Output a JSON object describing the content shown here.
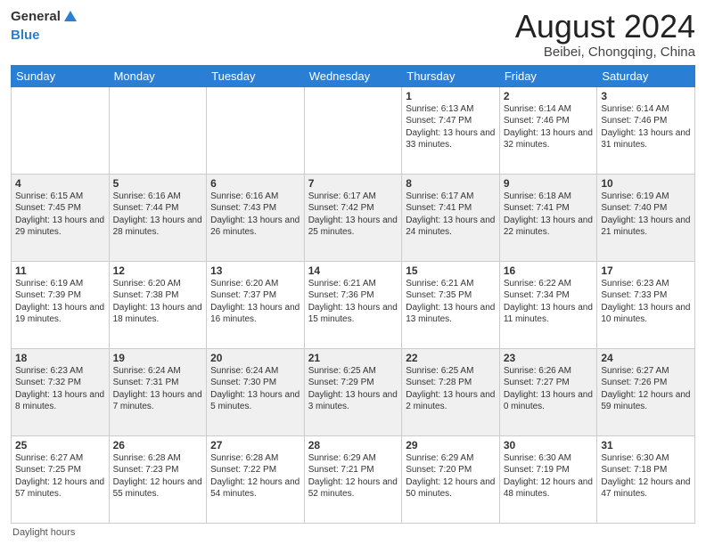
{
  "header": {
    "logo_general": "General",
    "logo_blue": "Blue",
    "month_year": "August 2024",
    "location": "Beibei, Chongqing, China"
  },
  "days_of_week": [
    "Sunday",
    "Monday",
    "Tuesday",
    "Wednesday",
    "Thursday",
    "Friday",
    "Saturday"
  ],
  "weeks": [
    [
      {
        "day": "",
        "info": ""
      },
      {
        "day": "",
        "info": ""
      },
      {
        "day": "",
        "info": ""
      },
      {
        "day": "",
        "info": ""
      },
      {
        "day": "1",
        "info": "Sunrise: 6:13 AM\nSunset: 7:47 PM\nDaylight: 13 hours and 33 minutes."
      },
      {
        "day": "2",
        "info": "Sunrise: 6:14 AM\nSunset: 7:46 PM\nDaylight: 13 hours and 32 minutes."
      },
      {
        "day": "3",
        "info": "Sunrise: 6:14 AM\nSunset: 7:46 PM\nDaylight: 13 hours and 31 minutes."
      }
    ],
    [
      {
        "day": "4",
        "info": "Sunrise: 6:15 AM\nSunset: 7:45 PM\nDaylight: 13 hours and 29 minutes."
      },
      {
        "day": "5",
        "info": "Sunrise: 6:16 AM\nSunset: 7:44 PM\nDaylight: 13 hours and 28 minutes."
      },
      {
        "day": "6",
        "info": "Sunrise: 6:16 AM\nSunset: 7:43 PM\nDaylight: 13 hours and 26 minutes."
      },
      {
        "day": "7",
        "info": "Sunrise: 6:17 AM\nSunset: 7:42 PM\nDaylight: 13 hours and 25 minutes."
      },
      {
        "day": "8",
        "info": "Sunrise: 6:17 AM\nSunset: 7:41 PM\nDaylight: 13 hours and 24 minutes."
      },
      {
        "day": "9",
        "info": "Sunrise: 6:18 AM\nSunset: 7:41 PM\nDaylight: 13 hours and 22 minutes."
      },
      {
        "day": "10",
        "info": "Sunrise: 6:19 AM\nSunset: 7:40 PM\nDaylight: 13 hours and 21 minutes."
      }
    ],
    [
      {
        "day": "11",
        "info": "Sunrise: 6:19 AM\nSunset: 7:39 PM\nDaylight: 13 hours and 19 minutes."
      },
      {
        "day": "12",
        "info": "Sunrise: 6:20 AM\nSunset: 7:38 PM\nDaylight: 13 hours and 18 minutes."
      },
      {
        "day": "13",
        "info": "Sunrise: 6:20 AM\nSunset: 7:37 PM\nDaylight: 13 hours and 16 minutes."
      },
      {
        "day": "14",
        "info": "Sunrise: 6:21 AM\nSunset: 7:36 PM\nDaylight: 13 hours and 15 minutes."
      },
      {
        "day": "15",
        "info": "Sunrise: 6:21 AM\nSunset: 7:35 PM\nDaylight: 13 hours and 13 minutes."
      },
      {
        "day": "16",
        "info": "Sunrise: 6:22 AM\nSunset: 7:34 PM\nDaylight: 13 hours and 11 minutes."
      },
      {
        "day": "17",
        "info": "Sunrise: 6:23 AM\nSunset: 7:33 PM\nDaylight: 13 hours and 10 minutes."
      }
    ],
    [
      {
        "day": "18",
        "info": "Sunrise: 6:23 AM\nSunset: 7:32 PM\nDaylight: 13 hours and 8 minutes."
      },
      {
        "day": "19",
        "info": "Sunrise: 6:24 AM\nSunset: 7:31 PM\nDaylight: 13 hours and 7 minutes."
      },
      {
        "day": "20",
        "info": "Sunrise: 6:24 AM\nSunset: 7:30 PM\nDaylight: 13 hours and 5 minutes."
      },
      {
        "day": "21",
        "info": "Sunrise: 6:25 AM\nSunset: 7:29 PM\nDaylight: 13 hours and 3 minutes."
      },
      {
        "day": "22",
        "info": "Sunrise: 6:25 AM\nSunset: 7:28 PM\nDaylight: 13 hours and 2 minutes."
      },
      {
        "day": "23",
        "info": "Sunrise: 6:26 AM\nSunset: 7:27 PM\nDaylight: 13 hours and 0 minutes."
      },
      {
        "day": "24",
        "info": "Sunrise: 6:27 AM\nSunset: 7:26 PM\nDaylight: 12 hours and 59 minutes."
      }
    ],
    [
      {
        "day": "25",
        "info": "Sunrise: 6:27 AM\nSunset: 7:25 PM\nDaylight: 12 hours and 57 minutes."
      },
      {
        "day": "26",
        "info": "Sunrise: 6:28 AM\nSunset: 7:23 PM\nDaylight: 12 hours and 55 minutes."
      },
      {
        "day": "27",
        "info": "Sunrise: 6:28 AM\nSunset: 7:22 PM\nDaylight: 12 hours and 54 minutes."
      },
      {
        "day": "28",
        "info": "Sunrise: 6:29 AM\nSunset: 7:21 PM\nDaylight: 12 hours and 52 minutes."
      },
      {
        "day": "29",
        "info": "Sunrise: 6:29 AM\nSunset: 7:20 PM\nDaylight: 12 hours and 50 minutes."
      },
      {
        "day": "30",
        "info": "Sunrise: 6:30 AM\nSunset: 7:19 PM\nDaylight: 12 hours and 48 minutes."
      },
      {
        "day": "31",
        "info": "Sunrise: 6:30 AM\nSunset: 7:18 PM\nDaylight: 12 hours and 47 minutes."
      }
    ]
  ],
  "footer": {
    "note": "Daylight hours"
  }
}
